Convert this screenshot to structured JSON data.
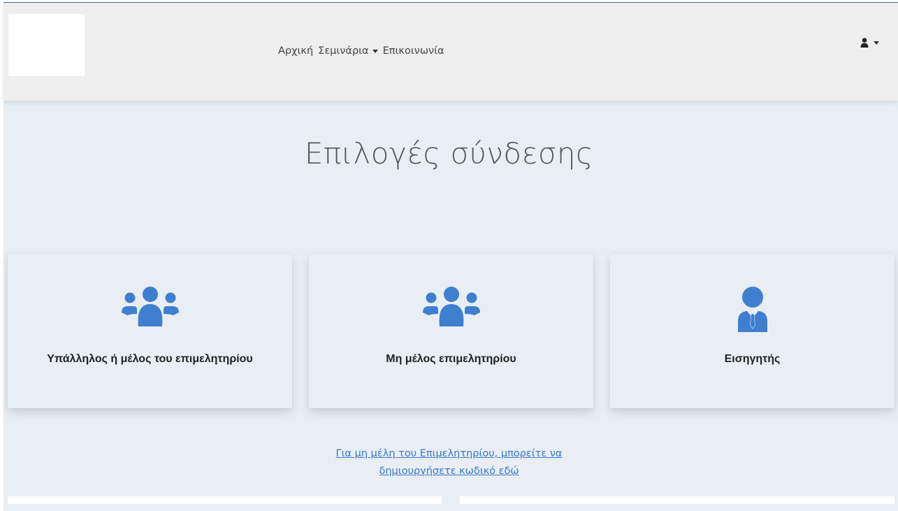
{
  "nav": {
    "items": [
      {
        "label": "Αρχική"
      },
      {
        "label": "Σεμινάρια"
      },
      {
        "label": "Επικοινωνία"
      }
    ]
  },
  "main": {
    "title": "Επιλογές σύνδεσης",
    "cards": [
      {
        "label": "Υπάλληλος ή μέλος του επιμελητηρίου",
        "icon": "users-icon"
      },
      {
        "label": "Μη μέλος επιμελητηρίου",
        "icon": "users-icon"
      },
      {
        "label": "Εισηγητής",
        "icon": "user-tie-icon"
      }
    ],
    "register_link": {
      "line1": "Για μη μέλη του Επιμελητηρίου, μπορείτε να",
      "line2": "δημιουργήσετε κωδικό εδώ"
    }
  },
  "colors": {
    "accent": "#3f7fcf",
    "navbar_bg": "#eeeeee",
    "page_bg": "#e9eef5",
    "link": "#3a78c9"
  }
}
